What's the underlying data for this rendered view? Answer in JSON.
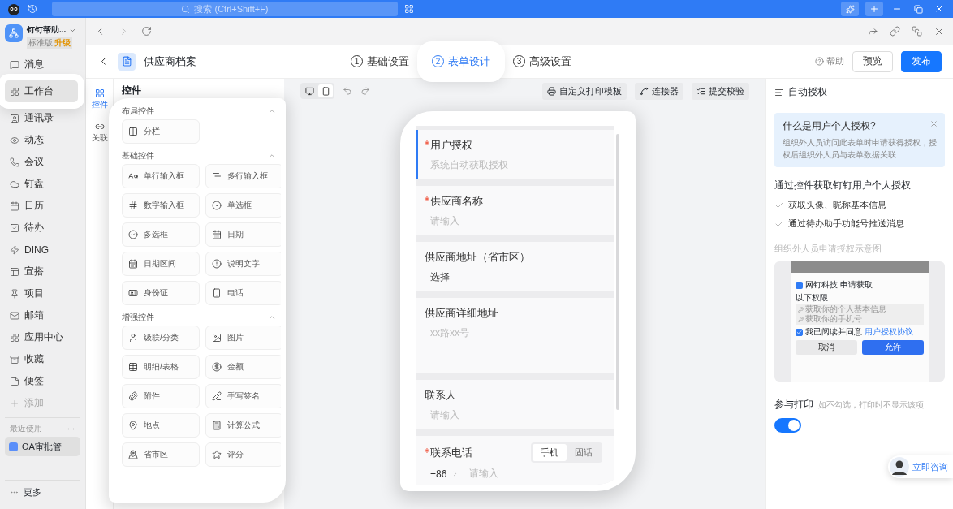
{
  "titlebar": {
    "search_placeholder": "搜索 (Ctrl+Shift+F)"
  },
  "org": {
    "name": "钉钉帮助...",
    "plan": "标准版",
    "upgrade": "升级"
  },
  "sidebar": {
    "items": [
      {
        "label": "消息",
        "kind": "nav",
        "selected": false
      },
      {
        "label": "工作台",
        "kind": "nav",
        "selected": true
      },
      {
        "label": "通讯录",
        "kind": "nav",
        "selected": false
      },
      {
        "label": "动态",
        "kind": "nav",
        "selected": false
      },
      {
        "label": "会议",
        "kind": "nav",
        "selected": false
      },
      {
        "label": "钉盘",
        "kind": "nav",
        "selected": false
      },
      {
        "label": "日历",
        "kind": "nav",
        "selected": false
      },
      {
        "label": "待办",
        "kind": "nav",
        "selected": false
      },
      {
        "label": "DING",
        "kind": "nav",
        "selected": false
      },
      {
        "label": "宜搭",
        "kind": "nav",
        "selected": false
      },
      {
        "label": "项目",
        "kind": "nav",
        "selected": false
      },
      {
        "label": "邮箱",
        "kind": "nav",
        "selected": false
      },
      {
        "label": "应用中心",
        "kind": "nav",
        "selected": false
      },
      {
        "label": "收藏",
        "kind": "nav",
        "selected": false
      },
      {
        "label": "便签",
        "kind": "nav",
        "selected": false
      },
      {
        "label": "添加",
        "kind": "add",
        "selected": false
      }
    ],
    "recent_label": "最近使用",
    "recent": [
      {
        "label": "OA审批管",
        "selected": true
      }
    ],
    "more": "更多"
  },
  "app": {
    "title": "供应商档案",
    "steps": [
      {
        "number": "1",
        "label": "基础设置",
        "selected": false
      },
      {
        "number": "2",
        "label": "表单设计",
        "selected": true
      },
      {
        "number": "3",
        "label": "高级设置",
        "selected": false
      }
    ],
    "help": "帮助",
    "preview": "预览",
    "publish": "发布"
  },
  "rail": [
    {
      "label": "控件",
      "selected": true
    },
    {
      "label": "关联",
      "selected": false
    }
  ],
  "palette": {
    "title": "控件",
    "sections": [
      {
        "title": "布局控件",
        "expanded": true,
        "items": [
          "分栏"
        ]
      },
      {
        "title": "基础控件",
        "expanded": true,
        "items": [
          "单行输入框",
          "多行输入框",
          "数字输入框",
          "单选框",
          "多选框",
          "日期",
          "日期区间",
          "说明文字",
          "身份证",
          "电话"
        ]
      },
      {
        "title": "增强控件",
        "expanded": true,
        "items": [
          "级联/分类",
          "图片",
          "明细/表格",
          "金额",
          "附件",
          "手写签名",
          "地点",
          "计算公式",
          "省市区",
          "评分"
        ]
      }
    ]
  },
  "toolbar": {
    "devices": [
      {
        "kind": "desktop",
        "selected": false
      },
      {
        "kind": "mobile",
        "selected": true
      }
    ],
    "actions": [
      "自定义打印模板",
      "连接器",
      "提交校验"
    ]
  },
  "form": {
    "fields": [
      {
        "kind": "text",
        "label": "用户授权",
        "required": true,
        "selected": true,
        "placeholder": "系统自动获取授权"
      },
      {
        "kind": "text",
        "label": "供应商名称",
        "required": true,
        "selected": false,
        "placeholder": "请输入"
      },
      {
        "kind": "select",
        "label": "供应商地址（省市区）",
        "required": false,
        "selected": false,
        "value": "选择"
      },
      {
        "kind": "textarea",
        "label": "供应商详细地址",
        "required": false,
        "selected": false,
        "placeholder": "xx路xx号"
      },
      {
        "kind": "text",
        "label": "联系人",
        "required": false,
        "selected": false,
        "placeholder": "请输入"
      },
      {
        "kind": "phone",
        "label": "联系电话",
        "required": true,
        "selected": false,
        "prefix": "+86",
        "placeholder": "请输入",
        "modes": [
          {
            "label": "手机",
            "selected": true
          },
          {
            "label": "固话",
            "selected": false
          }
        ]
      }
    ]
  },
  "settings": {
    "title": "自动授权",
    "tip": {
      "title": "什么是用户个人授权?",
      "text": "组织外人员访问此表单时申请获得授权，授权后组织外人员与表单数据关联"
    },
    "heading": "通过控件获取钉钉用户个人授权",
    "checks": [
      "获取头像、昵称基本信息",
      "通过待办助手功能号推送消息"
    ],
    "caption": "组织外人员申请授权示意图",
    "sample": {
      "app": "网钉科技",
      "request": "申请获取",
      "scope": "以下权限",
      "perms": [
        "获取你的个人基本信息",
        "获取你的手机号"
      ],
      "agree": "我已阅读并同意",
      "agreement": "用户授权协议",
      "agreed": true,
      "cancel": "取消",
      "allow": "允许"
    },
    "print": {
      "label": "参与打印",
      "hint": "如不勾选，打印时不显示该项",
      "on": true
    }
  },
  "consult": "立即咨询"
}
